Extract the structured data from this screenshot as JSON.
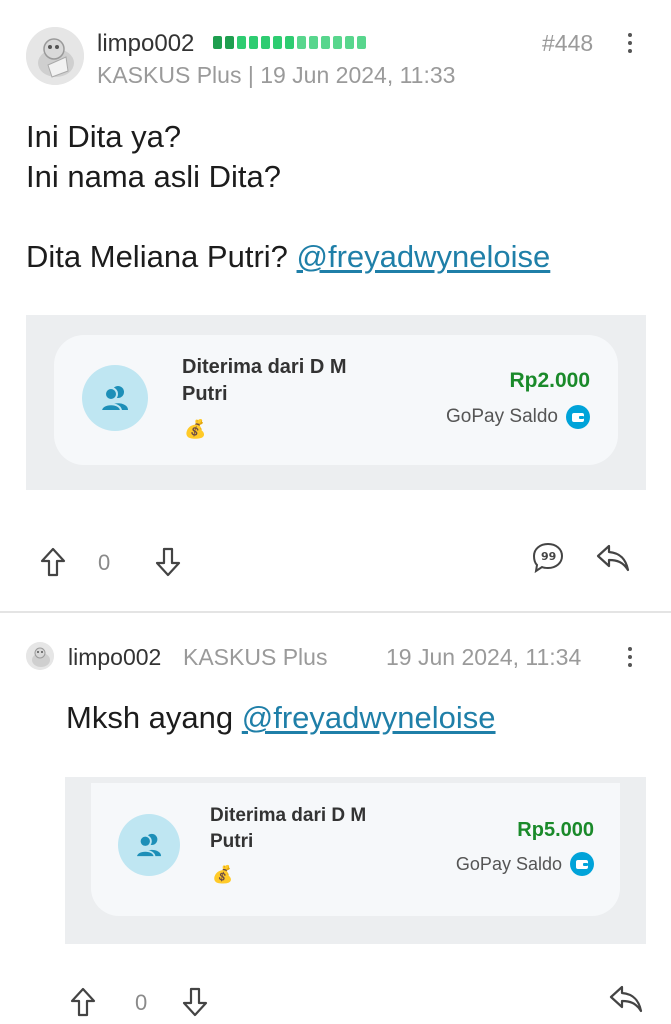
{
  "post1": {
    "username": "limpo002",
    "meta": "KASKUS Plus | 19 Jun 2024, 11:33",
    "post_number": "#448",
    "lines": [
      "Ini Dita ya?",
      "Ini nama asli Dita?"
    ],
    "question": "Dita Meliana Putri?",
    "mention": "@freyadwyneloise",
    "receipt": {
      "title_line1": "Diterima dari D M",
      "title_line2": "Putri",
      "amount": "Rp2.000",
      "wallet": "GoPay Saldo"
    },
    "vote_count": "0"
  },
  "post2": {
    "username": "limpo002",
    "badge": "KASKUS Plus",
    "timestamp": "19 Jun 2024, 11:34",
    "text": "Mksh ayang",
    "mention": "@freyadwyneloise",
    "receipt": {
      "title_line1": "Diterima dari D M",
      "title_line2": "Putri",
      "amount": "Rp5.000",
      "wallet": "GoPay Saldo"
    },
    "vote_count": "0"
  },
  "icons": {
    "upvote": "arrow-up-outline-icon",
    "downvote": "arrow-down-outline-icon",
    "quote": "quote-bubble-icon",
    "reply": "reply-arrow-icon",
    "more": "kebab-menu-icon",
    "receipt_user": "users-icon",
    "money_bag": "money-bag-icon",
    "gopay": "wallet-icon"
  },
  "colors": {
    "mention": "#1f7fa8",
    "amount": "#1a8a2a",
    "rank": "#2ecc71",
    "gopay": "#00a3d9"
  }
}
